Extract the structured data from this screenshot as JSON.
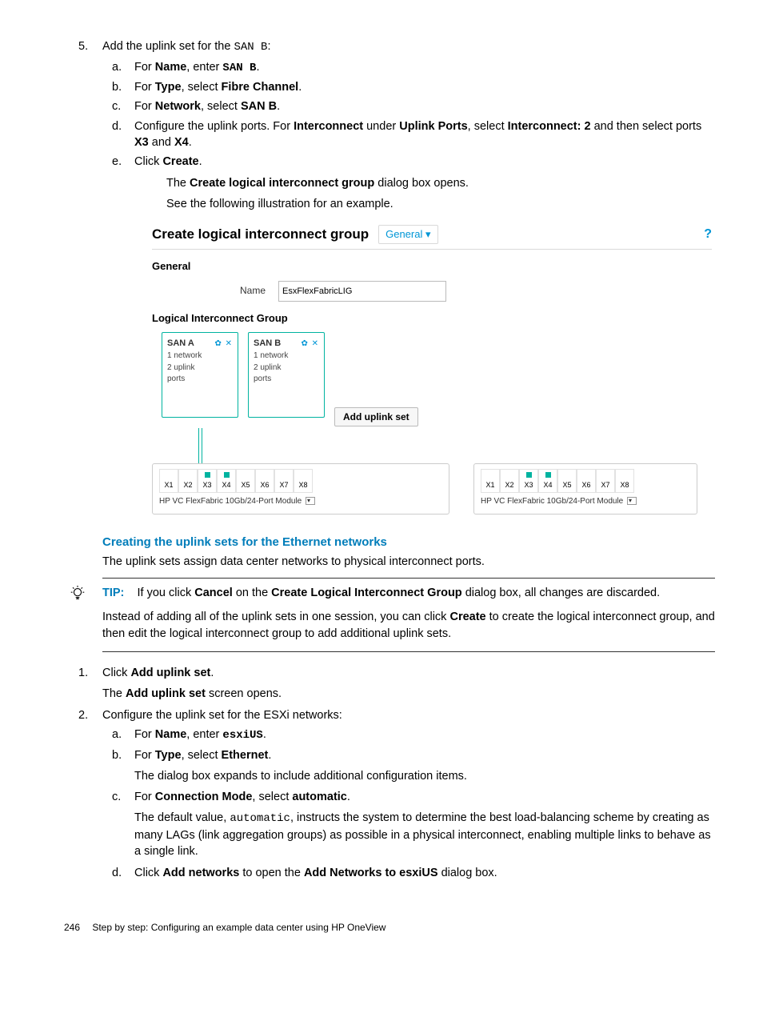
{
  "step5": {
    "num": "5.",
    "lead_pre": "Add the uplink set for the ",
    "lead_mono": "SAN B",
    "lead_post": ":",
    "a": {
      "alpha": "a.",
      "pre": "For ",
      "b1": "Name",
      "mid": ", enter ",
      "val": "SAN B",
      "post": "."
    },
    "b": {
      "alpha": "b.",
      "pre": "For ",
      "b1": "Type",
      "mid": ", select ",
      "b2": "Fibre Channel",
      "post": "."
    },
    "c": {
      "alpha": "c.",
      "pre": "For ",
      "b1": "Network",
      "mid": ", select ",
      "b2": "SAN B",
      "post": "."
    },
    "d": {
      "alpha": "d.",
      "pre": "Configure the uplink ports. For ",
      "b1": "Interconnect",
      "mid": " under ",
      "b2": "Uplink Ports",
      "mid2": ", select ",
      "b3": "Interconnect: 2",
      "mid3": " and then select ports ",
      "b4": "X3",
      "mid4": " and ",
      "b5": "X4",
      "post": "."
    },
    "e": {
      "alpha": "e.",
      "pre": "Click ",
      "b1": "Create",
      "post": ".",
      "p1_pre": "The ",
      "p1_b": "Create logical interconnect group",
      "p1_post": " dialog box opens.",
      "p2": "See the following illustration for an example."
    }
  },
  "screenshot": {
    "title": "Create logical interconnect group",
    "dropdown": "General ▾",
    "help": "?",
    "section_general": "General",
    "name_label": "Name",
    "name_value": "EsxFlexFabricLIG",
    "section_lig": "Logical Interconnect Group",
    "uplinkA": {
      "title": "SAN A",
      "icons": "✿ ✕",
      "l1": "1 network",
      "l2": "2 uplink",
      "l3": "ports"
    },
    "uplinkB": {
      "title": "SAN B",
      "icons": "✿ ✕",
      "l1": "1 network",
      "l2": "2 uplink",
      "l3": "ports"
    },
    "add_btn": "Add uplink set",
    "module_label": "HP VC FlexFabric 10Gb/24-Port Module",
    "ports": [
      "X1",
      "X2",
      "X3",
      "X4",
      "X5",
      "X6",
      "X7",
      "X8"
    ]
  },
  "ethernet_head": "Creating the uplink sets for the Ethernet networks",
  "ethernet_intro": "The uplink sets assign data center networks to physical interconnect ports.",
  "tip": {
    "label": "TIP:",
    "p1_pre": "If you click ",
    "p1_b1": "Cancel",
    "p1_mid": " on the ",
    "p1_b2": "Create Logical Interconnect Group",
    "p1_post": " dialog box, all changes are discarded.",
    "p2_pre": "Instead of adding all of the uplink sets in one session, you can click ",
    "p2_b": "Create",
    "p2_post": " to create the logical interconnect group, and then edit the logical interconnect group to add additional uplink sets."
  },
  "step1": {
    "num": "1.",
    "pre": "Click ",
    "b": "Add uplink set",
    "post": ".",
    "sub_pre": "The ",
    "sub_b": "Add uplink set",
    "sub_post": " screen opens."
  },
  "step2": {
    "num": "2.",
    "lead": "Configure the uplink set for the ESXi networks:",
    "a": {
      "alpha": "a.",
      "pre": "For ",
      "b1": "Name",
      "mid": ", enter ",
      "mono": "esxiUS",
      "post": "."
    },
    "b": {
      "alpha": "b.",
      "pre": "For ",
      "b1": "Type",
      "mid": ", select ",
      "b2": "Ethernet",
      "post": ".",
      "sub": "The dialog box expands to include additional configuration items."
    },
    "c": {
      "alpha": "c.",
      "pre": "For ",
      "b1": "Connection Mode",
      "mid": ", select ",
      "b2": "automatic",
      "post": ".",
      "sub_pre": "The default value, ",
      "sub_mono": "automatic",
      "sub_post": ", instructs the system to determine the best load-balancing scheme by creating as many LAGs (link aggregation groups) as possible in a physical interconnect, enabling multiple links to behave as a single link."
    },
    "d": {
      "alpha": "d.",
      "pre": "Click ",
      "b1": "Add networks",
      "mid": " to open the ",
      "b2": "Add Networks to esxiUS",
      "post": " dialog box."
    }
  },
  "footer": {
    "page": "246",
    "title": "Step by step: Configuring an example data center using HP OneView"
  }
}
